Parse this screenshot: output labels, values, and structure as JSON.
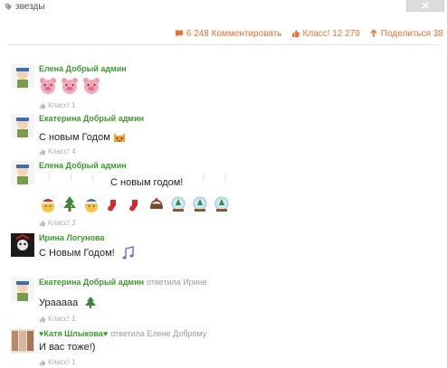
{
  "header": {
    "tag_icon": "tag-icon",
    "tag_label": "звезды",
    "close_icon": "close-icon"
  },
  "actions": {
    "comments": {
      "icon": "comment-icon",
      "label": "6 248 Комментировать"
    },
    "like": {
      "icon": "thumb-up-icon",
      "label": "Класс! 12 279"
    },
    "share": {
      "icon": "share-icon",
      "label": "Поделиться 38"
    }
  },
  "colors": {
    "accent": "#eb722e",
    "author": "#3a9b2a",
    "muted": "#aaaaaa"
  },
  "comments": [
    {
      "author": "Елена Добрый админ",
      "text": "",
      "emojis": [
        "pig-face-emoji",
        "pig-face-emoji",
        "pig-face-emoji"
      ],
      "likes": "Класс! 1"
    },
    {
      "author": "Екатерина Добрый админ",
      "text": "С новым Годом",
      "emojis": [
        "cat-face-emoji"
      ],
      "likes": "Класс! 4"
    },
    {
      "author": "Елена Добрый админ",
      "text": "С новым годом!",
      "emojis": [
        "santa-face-emoji",
        "christmas-tree-emoji",
        "santa-face-emoji",
        "stocking-emoji",
        "stocking-emoji",
        "pudding-emoji",
        "snow-globe-emoji",
        "snow-globe-emoji",
        "snow-globe-emoji"
      ],
      "likes": "Класс! 3"
    },
    {
      "author": "Ирина Логунова",
      "text": "С Новым Годом!",
      "emojis": [
        "music-note-emoji"
      ],
      "likes": ""
    },
    {
      "author": "Екатерина Добрый админ",
      "reply": "ответила Ирине",
      "text": "Урааааа",
      "emojis": [
        "christmas-tree-emoji"
      ],
      "likes": "Класс! 1"
    },
    {
      "author": "♥Катя Шлыкова♥",
      "reply": "ответила Елене Доброму",
      "text": "И вас тоже!)",
      "emojis": [],
      "likes": "Класс! 1"
    }
  ]
}
